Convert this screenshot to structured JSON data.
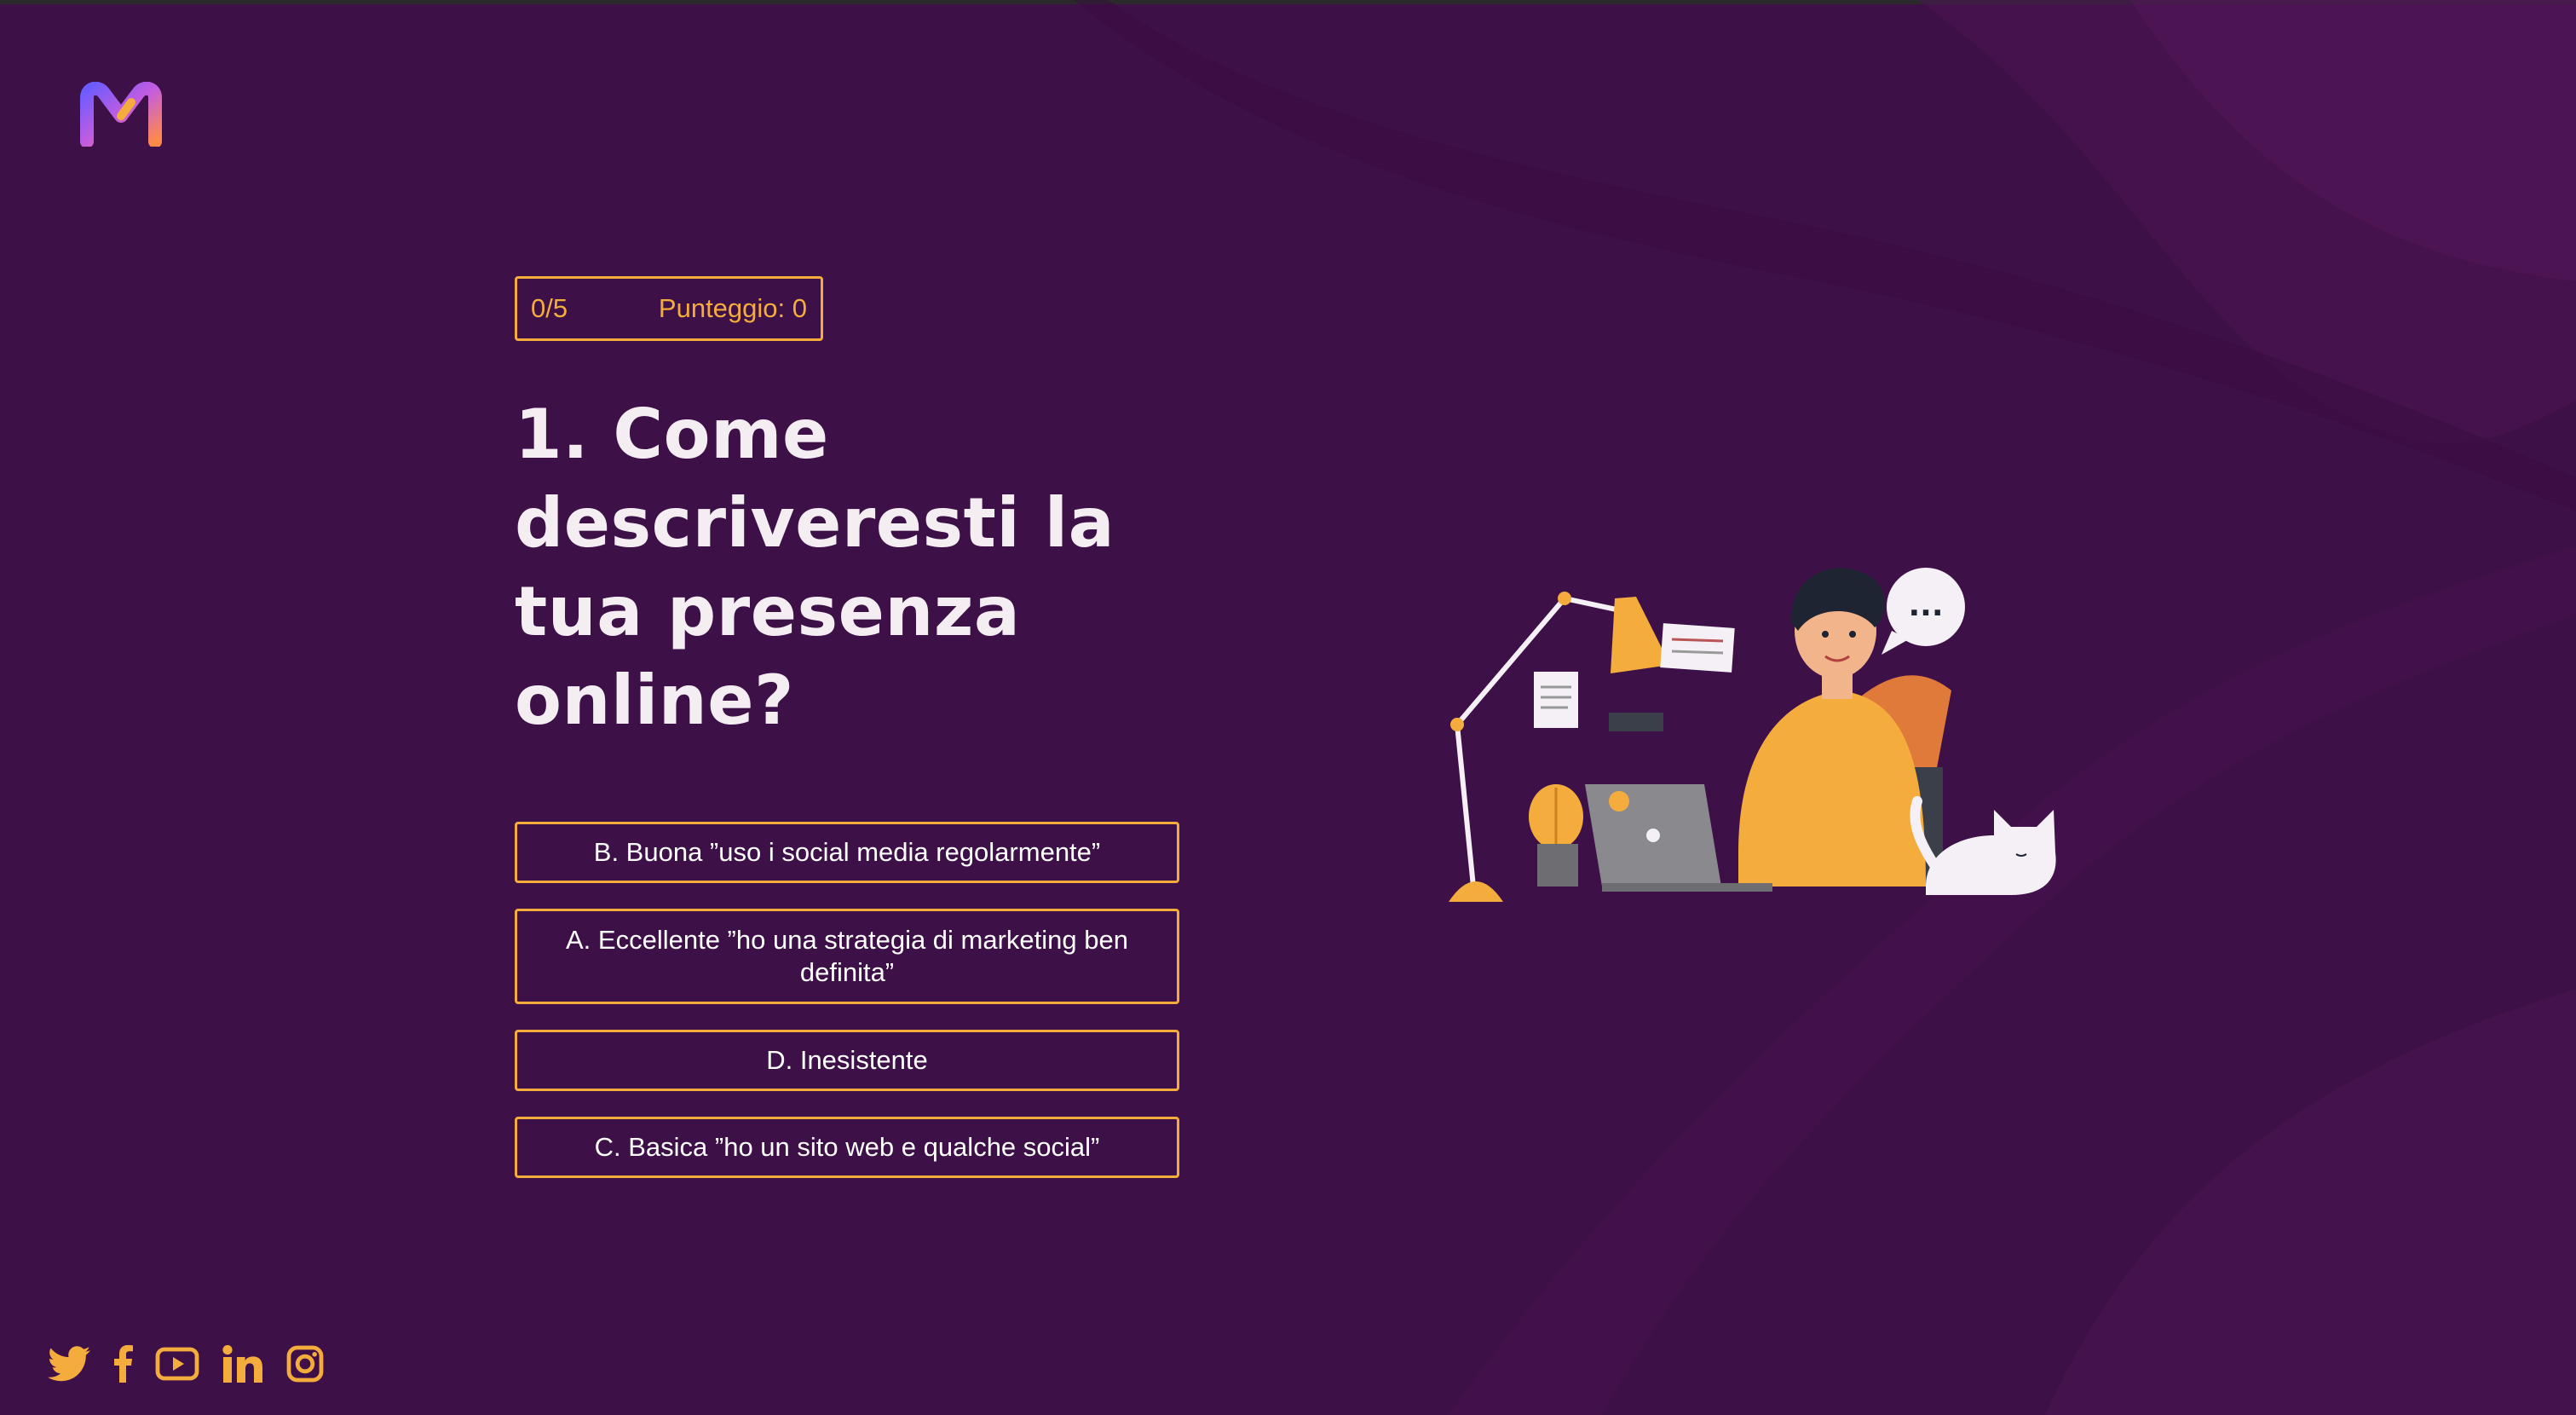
{
  "app": {
    "logo_icon": "m-logo-icon"
  },
  "colors": {
    "background": "#3e1048",
    "accent": "#f4ad3d",
    "text": "#f4eef3"
  },
  "status": {
    "progress": "0/5",
    "score": "Punteggio: 0"
  },
  "question": {
    "text": "1. Come descriveresti la tua presenza online?"
  },
  "answers": [
    {
      "label": "B. Buona ”uso i social media regolarmente”"
    },
    {
      "label": "A. Eccellente ”ho una strategia di marketing ben definita”"
    },
    {
      "label": "D. Inesistente"
    },
    {
      "label": "C. Basica ”ho un sito web e qualche social”"
    }
  ],
  "illustration": {
    "icon": "person-at-laptop-illustration",
    "speech_bubble": "..."
  },
  "social": {
    "icons": [
      "twitter-icon",
      "facebook-icon",
      "youtube-icon",
      "linkedin-icon",
      "instagram-icon"
    ]
  }
}
